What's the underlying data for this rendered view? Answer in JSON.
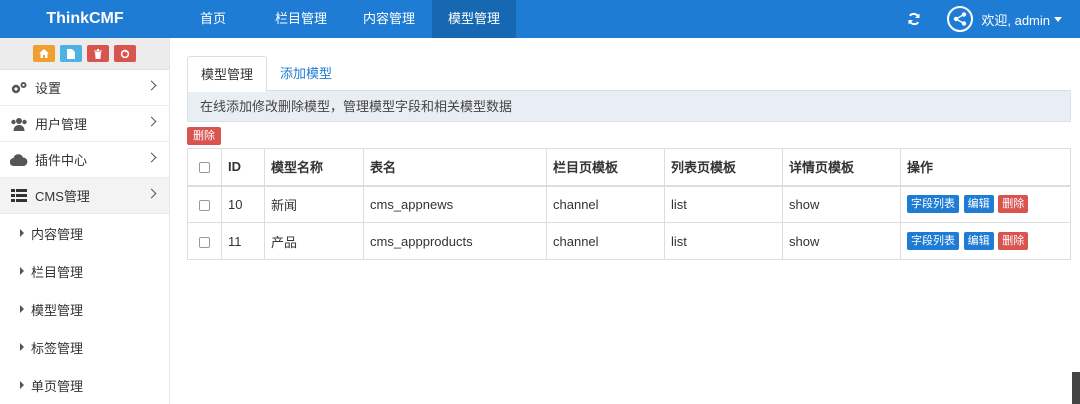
{
  "app": {
    "brand": "ThinkCMF"
  },
  "nav": {
    "items": [
      {
        "label": "首页"
      },
      {
        "label": "栏目管理"
      },
      {
        "label": "内容管理"
      },
      {
        "label": "模型管理"
      }
    ],
    "active_index": 3,
    "welcome": "欢迎, admin",
    "icons": {
      "refresh": "refresh-icon",
      "avatar": "share-node-icon",
      "dropdown": "caret-down-icon"
    }
  },
  "sidebar": {
    "shortcuts": [
      {
        "icon": "home-icon",
        "color": "#f0a02f"
      },
      {
        "icon": "file-icon",
        "color": "#4cb3e4"
      },
      {
        "icon": "trash-icon",
        "color": "#d9534f"
      },
      {
        "icon": "recycle-icon",
        "color": "#d9534f"
      }
    ],
    "items": [
      {
        "label": "设置",
        "icon": "gears-icon"
      },
      {
        "label": "用户管理",
        "icon": "users-icon"
      },
      {
        "label": "插件中心",
        "icon": "cloud-icon"
      },
      {
        "label": "CMS管理",
        "icon": "list-icon"
      }
    ],
    "sub_items": [
      {
        "label": "内容管理"
      },
      {
        "label": "栏目管理"
      },
      {
        "label": "模型管理"
      },
      {
        "label": "标签管理"
      },
      {
        "label": "单页管理"
      }
    ]
  },
  "main": {
    "tabs": [
      {
        "label": "模型管理"
      },
      {
        "label": "添加模型"
      }
    ],
    "alert": "在线添加修改删除模型，管理模型字段和相关模型数据",
    "bulk_delete": "删除",
    "table": {
      "headers": [
        "ID",
        "模型名称",
        "表名",
        "栏目页模板",
        "列表页模板",
        "详情页模板",
        "操作"
      ],
      "rows": [
        {
          "id": "10",
          "name": "新闻",
          "table": "cms_appnews",
          "channel_tpl": "channel",
          "list_tpl": "list",
          "detail_tpl": "show"
        },
        {
          "id": "11",
          "name": "产品",
          "table": "cms_appproducts",
          "channel_tpl": "channel",
          "list_tpl": "list",
          "detail_tpl": "show"
        }
      ],
      "actions": {
        "fields": "字段列表",
        "edit": "编辑",
        "delete": "删除"
      }
    }
  },
  "colors": {
    "primary": "#1f7cd4",
    "danger": "#d9534f",
    "alert_bg": "#e8eef3"
  }
}
